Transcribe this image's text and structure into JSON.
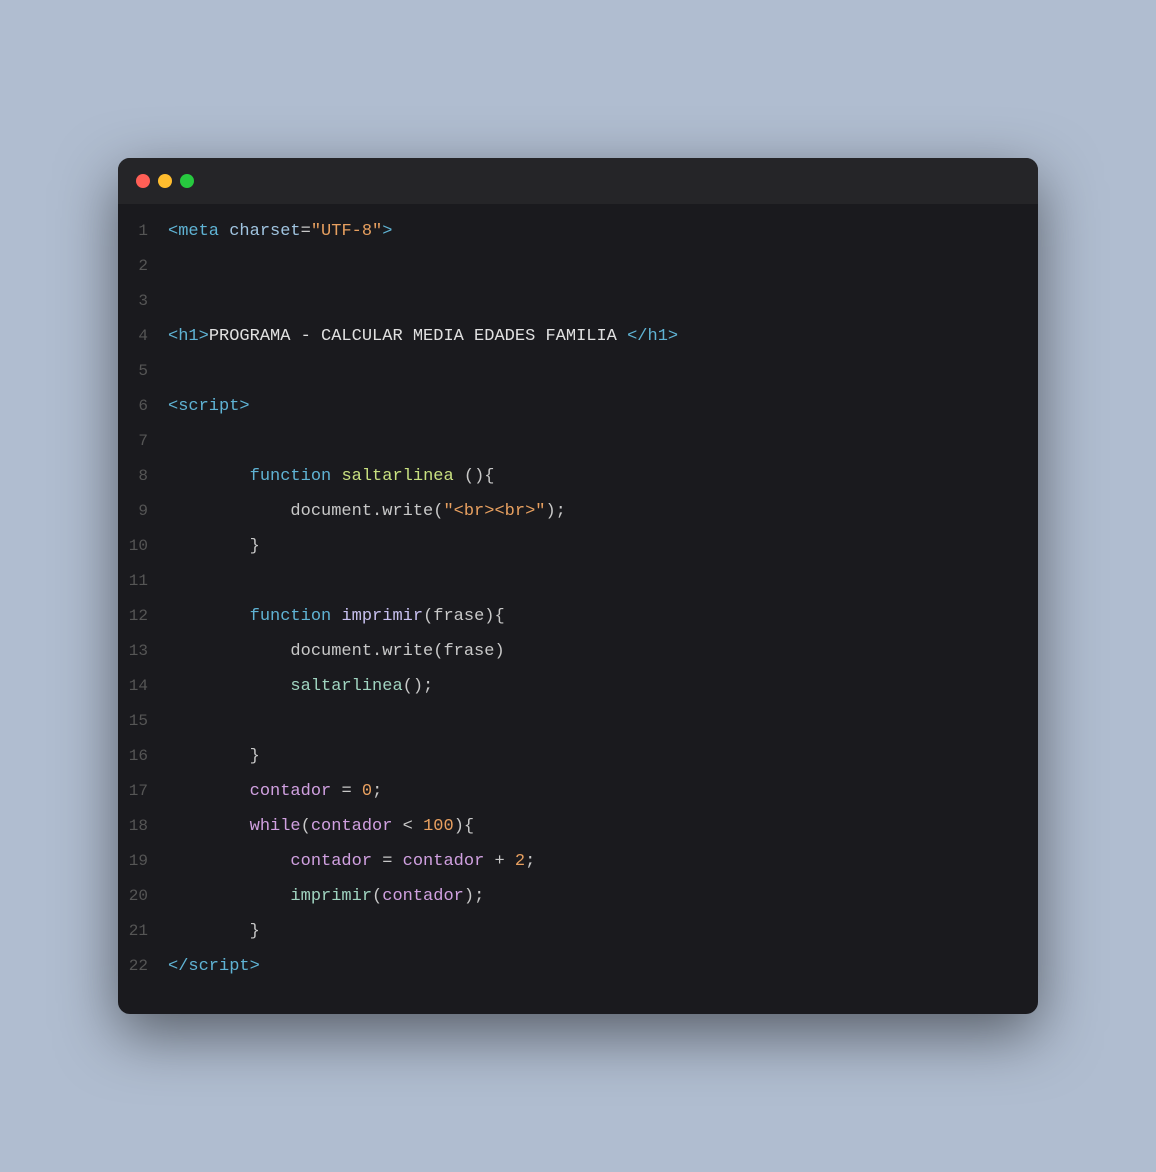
{
  "window": {
    "dots": [
      {
        "color": "red",
        "class": "dot-red"
      },
      {
        "color": "yellow",
        "class": "dot-yellow"
      },
      {
        "color": "green",
        "class": "dot-green"
      }
    ]
  },
  "lines": [
    {
      "num": 1,
      "content": "meta_charset"
    },
    {
      "num": 2,
      "content": "empty"
    },
    {
      "num": 3,
      "content": "empty"
    },
    {
      "num": 4,
      "content": "h1_line"
    },
    {
      "num": 5,
      "content": "empty"
    },
    {
      "num": 6,
      "content": "script_open"
    },
    {
      "num": 7,
      "content": "empty"
    },
    {
      "num": 8,
      "content": "fn_saltarlinea"
    },
    {
      "num": 9,
      "content": "doc_write_br"
    },
    {
      "num": 10,
      "content": "close_brace_indent1"
    },
    {
      "num": 11,
      "content": "empty"
    },
    {
      "num": 12,
      "content": "fn_imprimir"
    },
    {
      "num": 13,
      "content": "doc_write_frase"
    },
    {
      "num": 14,
      "content": "saltarlinea_call"
    },
    {
      "num": 15,
      "content": "empty"
    },
    {
      "num": 16,
      "content": "close_brace_indent1"
    },
    {
      "num": 17,
      "content": "contador_assign"
    },
    {
      "num": 18,
      "content": "while_line"
    },
    {
      "num": 19,
      "content": "contador_plus"
    },
    {
      "num": 20,
      "content": "imprimir_call"
    },
    {
      "num": 21,
      "content": "close_brace_indent1"
    },
    {
      "num": 22,
      "content": "script_close"
    }
  ]
}
